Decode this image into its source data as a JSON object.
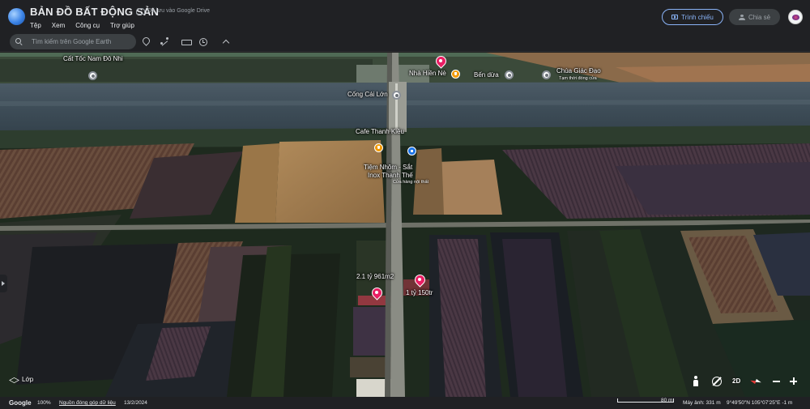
{
  "header": {
    "doc_title": "BẢN ĐỒ BẤT ĐỘNG SẢN",
    "drive_status": "Đã lưu vào Google Drive",
    "menu": [
      "Tệp",
      "Xem",
      "Công cụ",
      "Trợ giúp"
    ],
    "present_label": "Trình chiếu",
    "share_label": "Chia sẻ"
  },
  "toolbar": {
    "search_placeholder": "Tìm kiếm trên Google Earth",
    "tools": [
      "pin-icon",
      "path-icon",
      "ruler-icon",
      "history-icon",
      "chevron-up-icon"
    ]
  },
  "map": {
    "labels": {
      "cao_toc": "Cất Tốc Nam Đô Nhi",
      "nha_hien_ne": "Nhà Hiền Nè",
      "ben_dua": "Bến dừa",
      "chua_giac_dao": "Chùa Giác Đạo",
      "chua_giac_dao_status": "Tạm thời đóng cửa",
      "cong_cai_lon": "Cống Cái Lớn",
      "cafe_thanh_kieu": "Cafe Thanh Kiều",
      "tiem_nhom_line1": "Tiệm Nhôm - Sắt",
      "tiem_nhom_line2": "Inox Thanh Thế",
      "tiem_nhom_sub": "Cửa hàng nội thất",
      "lot_1": "2.1 tỷ 961m2",
      "lot_2": "1 tỷ 150tr"
    },
    "layers_label": "Lớp",
    "view_mode": "2D"
  },
  "status": {
    "logo": "Google",
    "zoom": "100%",
    "data_source": "Nguồn đóng góp dữ liệu",
    "imagery_date": "13/2/2024",
    "scale": "80 m",
    "camera_alt": "Máy ảnh: 331 m",
    "coords": "9°49'50\"N 105°07'25\"E",
    "elevation": "-1 m"
  },
  "colors": {
    "accent": "#8ab4f8",
    "pin": "#e91e63",
    "poi_orange": "#f29900",
    "poi_blue": "#1a73e8"
  }
}
